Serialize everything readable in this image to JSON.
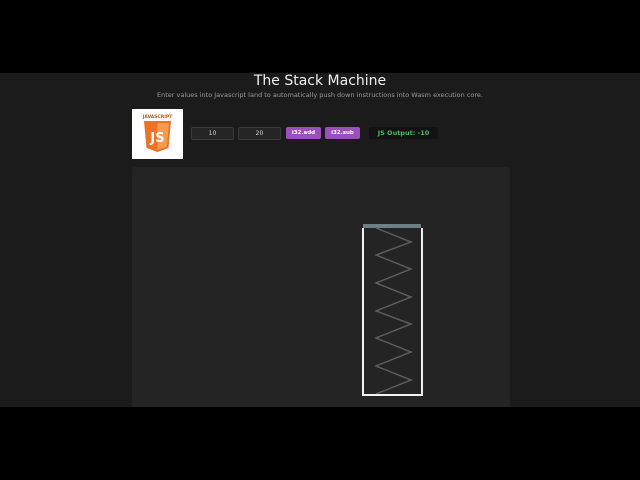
{
  "header": {
    "title": "The Stack Machine",
    "subtitle": "Enter values into Javascript land to automatically push down instructions into Wasm execution core."
  },
  "logo": {
    "text": "JAVASCRIPT",
    "badge": "JS",
    "icon": "javascript-shield-icon",
    "color": "#e8742c"
  },
  "controls": {
    "input_a": "10",
    "input_b": "20",
    "add_label": "i32.add",
    "sub_label": "i32.sub",
    "output_label": "JS Output: -10"
  },
  "colors": {
    "accent": "#9b4fbf",
    "output_text": "#3fbf60",
    "background": "#1b1b1b",
    "stage": "#242424"
  }
}
